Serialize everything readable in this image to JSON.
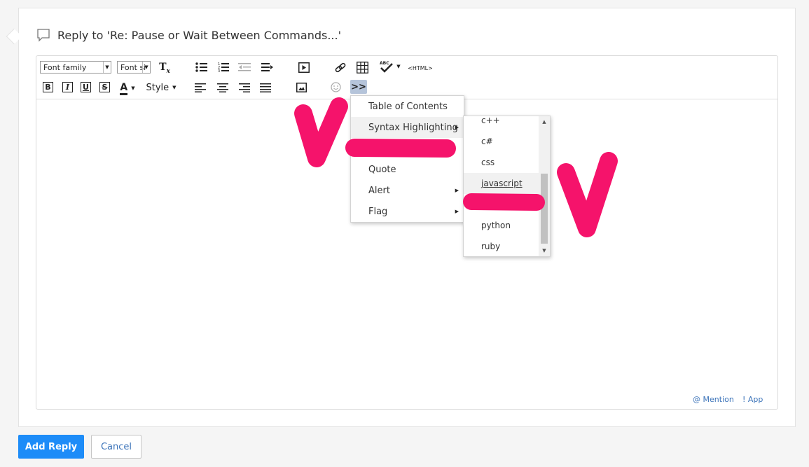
{
  "reply": {
    "title": "Reply to 'Re: Pause or Wait Between Commands...'"
  },
  "toolbar": {
    "font_family": "Font family",
    "font_size": "Font si",
    "clear_format": "Tx",
    "bold": "B",
    "italic": "I",
    "underline": "U",
    "strike": "S",
    "text_color": "A",
    "style": "Style",
    "html": "<HTML>",
    "more": ">>"
  },
  "insert_menu": {
    "items": [
      {
        "label": "Table of Contents",
        "has_submenu": false
      },
      {
        "label": "Syntax Highlighting",
        "has_submenu": true
      },
      {
        "label": "Quote",
        "has_submenu": false
      },
      {
        "label": "Alert",
        "has_submenu": true
      },
      {
        "label": "Flag",
        "has_submenu": true
      }
    ]
  },
  "syntax_submenu": {
    "items": [
      "c++",
      "c#",
      "css",
      "javascript",
      "python",
      "ruby"
    ],
    "hovered": "javascript"
  },
  "editor_footer": {
    "mention": "@ Mention",
    "app": "! App"
  },
  "buttons": {
    "add_reply": "Add Reply",
    "cancel": "Cancel"
  },
  "colors": {
    "primary": "#1d8cf8",
    "link": "#3b73b9",
    "annotation": "#f5136b",
    "active_button": "#b5c4da"
  }
}
